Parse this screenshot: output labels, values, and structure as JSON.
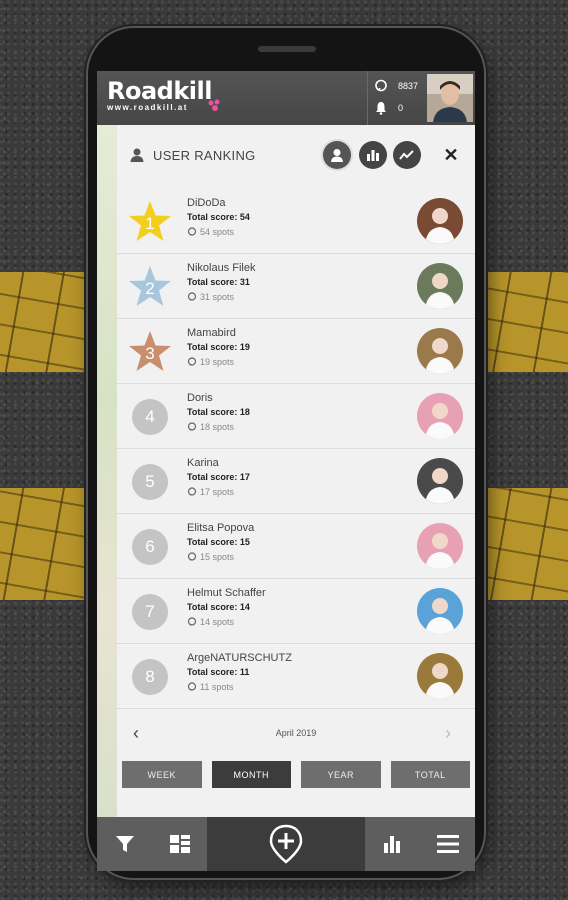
{
  "app": {
    "logo_text": "Roadkill",
    "logo_url": "www.roadkill.at"
  },
  "stats": {
    "spots_count": "8837",
    "notifications_count": "0"
  },
  "panel": {
    "title": "USER RANKING"
  },
  "rankings": [
    {
      "rank": "1",
      "name": "DiDoDa",
      "score": "Total score: 54",
      "spots": "54 spots",
      "badge": "gold-star",
      "color": "#f2cf1e",
      "avatar_color": "#7a4a34"
    },
    {
      "rank": "2",
      "name": "Nikolaus Filek",
      "score": "Total score: 31",
      "spots": "31 spots",
      "badge": "silver-star",
      "color": "#a9c7dc",
      "avatar_color": "#6a7a5a"
    },
    {
      "rank": "3",
      "name": "Mamabird",
      "score": "Total score: 19",
      "spots": "19 spots",
      "badge": "bronze-star",
      "color": "#c98e6e",
      "avatar_color": "#9a7a4a"
    },
    {
      "rank": "4",
      "name": "Doris",
      "score": "Total score: 18",
      "spots": "18 spots",
      "badge": "circle",
      "color": "#c4c4c4",
      "avatar_color": "#e8a0b4"
    },
    {
      "rank": "5",
      "name": "Karina",
      "score": "Total score: 17",
      "spots": "17 spots",
      "badge": "circle",
      "color": "#c4c4c4",
      "avatar_color": "#4a4a4a"
    },
    {
      "rank": "6",
      "name": "Elitsa Popova",
      "score": "Total score: 15",
      "spots": "15 spots",
      "badge": "circle",
      "color": "#c4c4c4",
      "avatar_color": "#e8a0b4"
    },
    {
      "rank": "7",
      "name": "Helmut Schaffer",
      "score": "Total score: 14",
      "spots": "14 spots",
      "badge": "circle",
      "color": "#c4c4c4",
      "avatar_color": "#5aa2d8"
    },
    {
      "rank": "8",
      "name": "ArgeNATURSCHUTZ",
      "score": "Total score: 11",
      "spots": "11 spots",
      "badge": "circle",
      "color": "#c4c4c4",
      "avatar_color": "#9a7a3a"
    }
  ],
  "month_nav": {
    "label": "April 2019",
    "prev": "‹",
    "next": "›"
  },
  "periods": [
    {
      "label": "WEEK",
      "active": false
    },
    {
      "label": "MONTH",
      "active": true
    },
    {
      "label": "YEAR",
      "active": false
    },
    {
      "label": "TOTAL",
      "active": false
    }
  ],
  "close_label": "✕",
  "colors": {
    "topbar": "#4a4a4a",
    "active_period": "#3c3c3c",
    "period": "#6e6e6e"
  }
}
